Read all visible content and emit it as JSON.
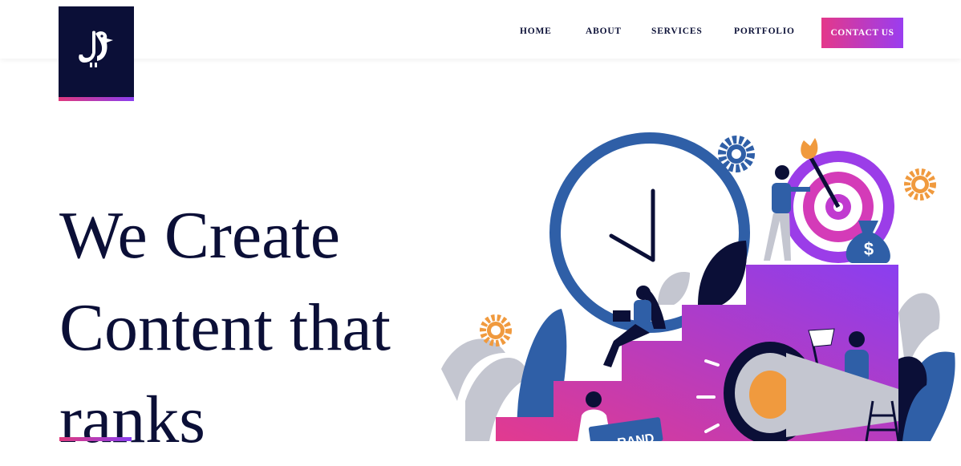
{
  "brand": {
    "logo_icon": "bird-logo-icon",
    "accent_start": "#e0397d",
    "accent_end": "#8a3ef0",
    "navy": "#0b0f37"
  },
  "nav": {
    "items": [
      {
        "label": "HOME"
      },
      {
        "label": "ABOUT"
      },
      {
        "label": "SERVICES"
      },
      {
        "label": "PORTFOLIO"
      }
    ],
    "cta_label": "CONTACT US"
  },
  "hero": {
    "title_lines": [
      "We Create",
      "Content that",
      "ranks"
    ],
    "illustration_sign_text": "RAND"
  }
}
